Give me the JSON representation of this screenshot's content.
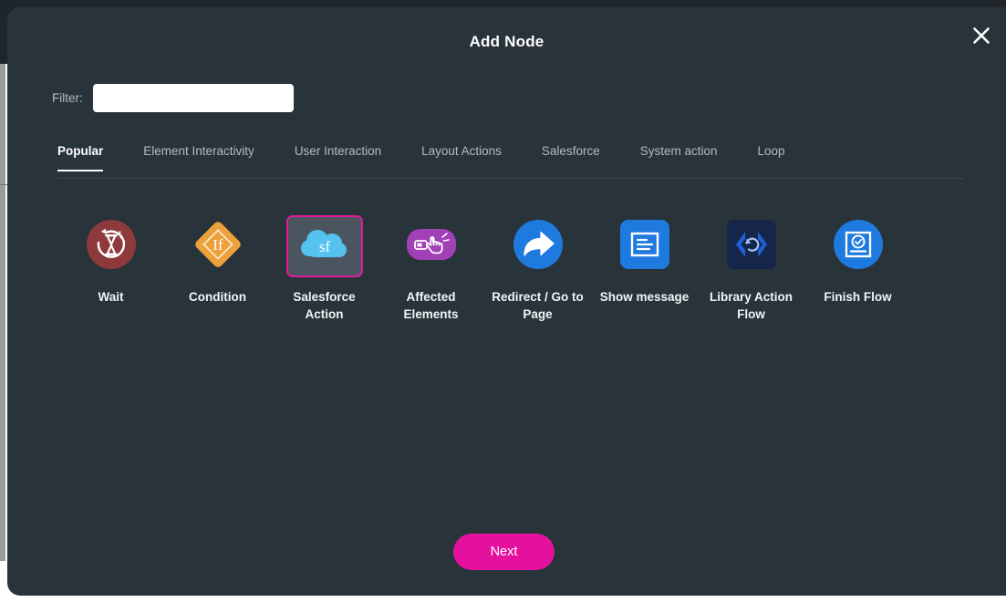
{
  "modal": {
    "title": "Add Node",
    "close_icon": "close-icon"
  },
  "filter": {
    "label": "Filter:",
    "value": "",
    "placeholder": ""
  },
  "tabs": [
    {
      "label": "Popular",
      "active": true
    },
    {
      "label": "Element Interactivity",
      "active": false
    },
    {
      "label": "User Interaction",
      "active": false
    },
    {
      "label": "Layout Actions",
      "active": false
    },
    {
      "label": "Salesforce",
      "active": false
    },
    {
      "label": "System action",
      "active": false
    },
    {
      "label": "Loop",
      "active": false
    }
  ],
  "nodes": [
    {
      "label": "Wait",
      "icon": "hourglass-refresh-icon",
      "selected": false
    },
    {
      "label": "Condition",
      "icon": "condition-diamond-if-icon",
      "selected": false
    },
    {
      "label": "Salesforce Action",
      "icon": "salesforce-cloud-sf-icon",
      "selected": true
    },
    {
      "label": "Affected Elements",
      "icon": "hand-cursor-element-icon",
      "selected": false
    },
    {
      "label": "Redirect / Go to Page",
      "icon": "redirect-arrow-icon",
      "selected": false
    },
    {
      "label": "Show message",
      "icon": "message-document-icon",
      "selected": false
    },
    {
      "label": "Library Action Flow",
      "icon": "code-brackets-refresh-icon",
      "selected": false
    },
    {
      "label": "Finish Flow",
      "icon": "finish-checkmark-document-icon",
      "selected": false
    }
  ],
  "footer": {
    "next_label": "Next"
  },
  "colors": {
    "modal_background": "#28333a",
    "accent_magenta": "#e4119e",
    "selected_tile_background": "#4b555f",
    "wait_icon": "#8e3a3c",
    "condition_icon": "#eda13b",
    "salesforce_cloud": "#54c3ef",
    "affected_elements_icon": "#a240b8",
    "blue_icon": "#1f7ae0",
    "library_icon": "#16254a"
  }
}
